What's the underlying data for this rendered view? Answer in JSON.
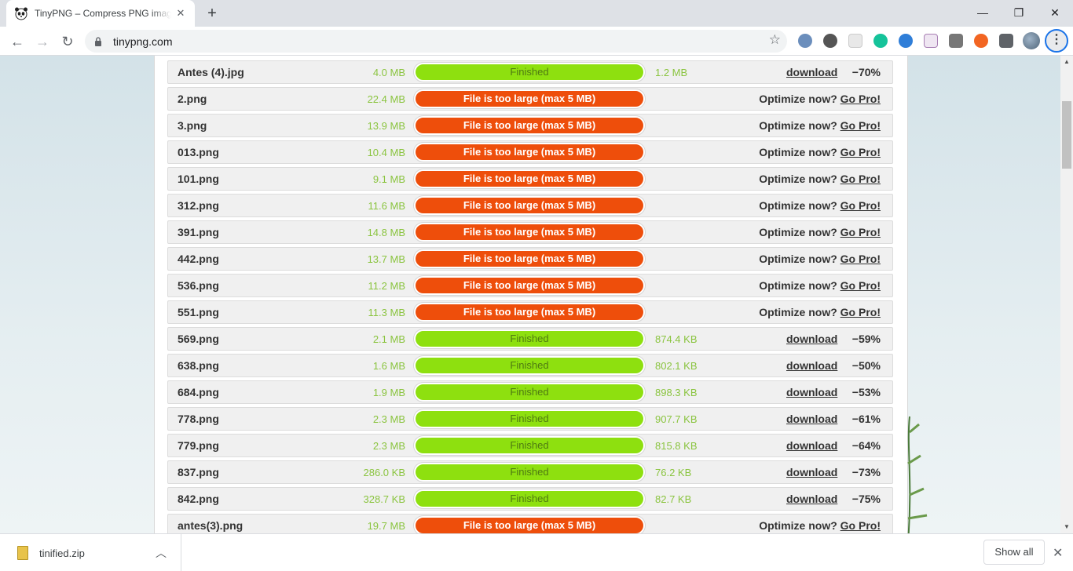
{
  "browser": {
    "tab_title": "TinyPNG – Compress PNG images",
    "url": "tinypng.com",
    "new_tab_label": "+",
    "minimize_glyph": "—",
    "restore_glyph": "❐",
    "close_glyph": "✕"
  },
  "files": [
    {
      "name": "Antes (4).jpg",
      "size": "4.0 MB",
      "status": "ok",
      "status_text": "Finished",
      "new_size": "1.2 MB",
      "action": "download",
      "saving": "−70%"
    },
    {
      "name": "2.png",
      "size": "22.4 MB",
      "status": "err",
      "status_text": "File is too large (max 5 MB)",
      "optimize_text": "Optimize now?",
      "go_pro": "Go Pro!"
    },
    {
      "name": "3.png",
      "size": "13.9 MB",
      "status": "err",
      "status_text": "File is too large (max 5 MB)",
      "optimize_text": "Optimize now?",
      "go_pro": "Go Pro!"
    },
    {
      "name": "013.png",
      "size": "10.4 MB",
      "status": "err",
      "status_text": "File is too large (max 5 MB)",
      "optimize_text": "Optimize now?",
      "go_pro": "Go Pro!"
    },
    {
      "name": "101.png",
      "size": "9.1 MB",
      "status": "err",
      "status_text": "File is too large (max 5 MB)",
      "optimize_text": "Optimize now?",
      "go_pro": "Go Pro!"
    },
    {
      "name": "312.png",
      "size": "11.6 MB",
      "status": "err",
      "status_text": "File is too large (max 5 MB)",
      "optimize_text": "Optimize now?",
      "go_pro": "Go Pro!"
    },
    {
      "name": "391.png",
      "size": "14.8 MB",
      "status": "err",
      "status_text": "File is too large (max 5 MB)",
      "optimize_text": "Optimize now?",
      "go_pro": "Go Pro!"
    },
    {
      "name": "442.png",
      "size": "13.7 MB",
      "status": "err",
      "status_text": "File is too large (max 5 MB)",
      "optimize_text": "Optimize now?",
      "go_pro": "Go Pro!"
    },
    {
      "name": "536.png",
      "size": "11.2 MB",
      "status": "err",
      "status_text": "File is too large (max 5 MB)",
      "optimize_text": "Optimize now?",
      "go_pro": "Go Pro!"
    },
    {
      "name": "551.png",
      "size": "11.3 MB",
      "status": "err",
      "status_text": "File is too large (max 5 MB)",
      "optimize_text": "Optimize now?",
      "go_pro": "Go Pro!"
    },
    {
      "name": "569.png",
      "size": "2.1 MB",
      "status": "ok",
      "status_text": "Finished",
      "new_size": "874.4 KB",
      "action": "download",
      "saving": "−59%"
    },
    {
      "name": "638.png",
      "size": "1.6 MB",
      "status": "ok",
      "status_text": "Finished",
      "new_size": "802.1 KB",
      "action": "download",
      "saving": "−50%"
    },
    {
      "name": "684.png",
      "size": "1.9 MB",
      "status": "ok",
      "status_text": "Finished",
      "new_size": "898.3 KB",
      "action": "download",
      "saving": "−53%"
    },
    {
      "name": "778.png",
      "size": "2.3 MB",
      "status": "ok",
      "status_text": "Finished",
      "new_size": "907.7 KB",
      "action": "download",
      "saving": "−61%"
    },
    {
      "name": "779.png",
      "size": "2.3 MB",
      "status": "ok",
      "status_text": "Finished",
      "new_size": "815.8 KB",
      "action": "download",
      "saving": "−64%"
    },
    {
      "name": "837.png",
      "size": "286.0 KB",
      "status": "ok",
      "status_text": "Finished",
      "new_size": "76.2 KB",
      "action": "download",
      "saving": "−73%"
    },
    {
      "name": "842.png",
      "size": "328.7 KB",
      "status": "ok",
      "status_text": "Finished",
      "new_size": "82.7 KB",
      "action": "download",
      "saving": "−75%"
    },
    {
      "name": "antes(3).png",
      "size": "19.7 MB",
      "status": "err",
      "status_text": "File is too large (max 5 MB)",
      "optimize_text": "Optimize now?",
      "go_pro": "Go Pro!"
    }
  ],
  "colors": {
    "finished_bar": "#8ee00f",
    "error_bar": "#ee4e0b",
    "size_text": "#8ac43f"
  },
  "download_bar": {
    "file_name": "tinified.zip",
    "show_all_label": "Show all"
  }
}
